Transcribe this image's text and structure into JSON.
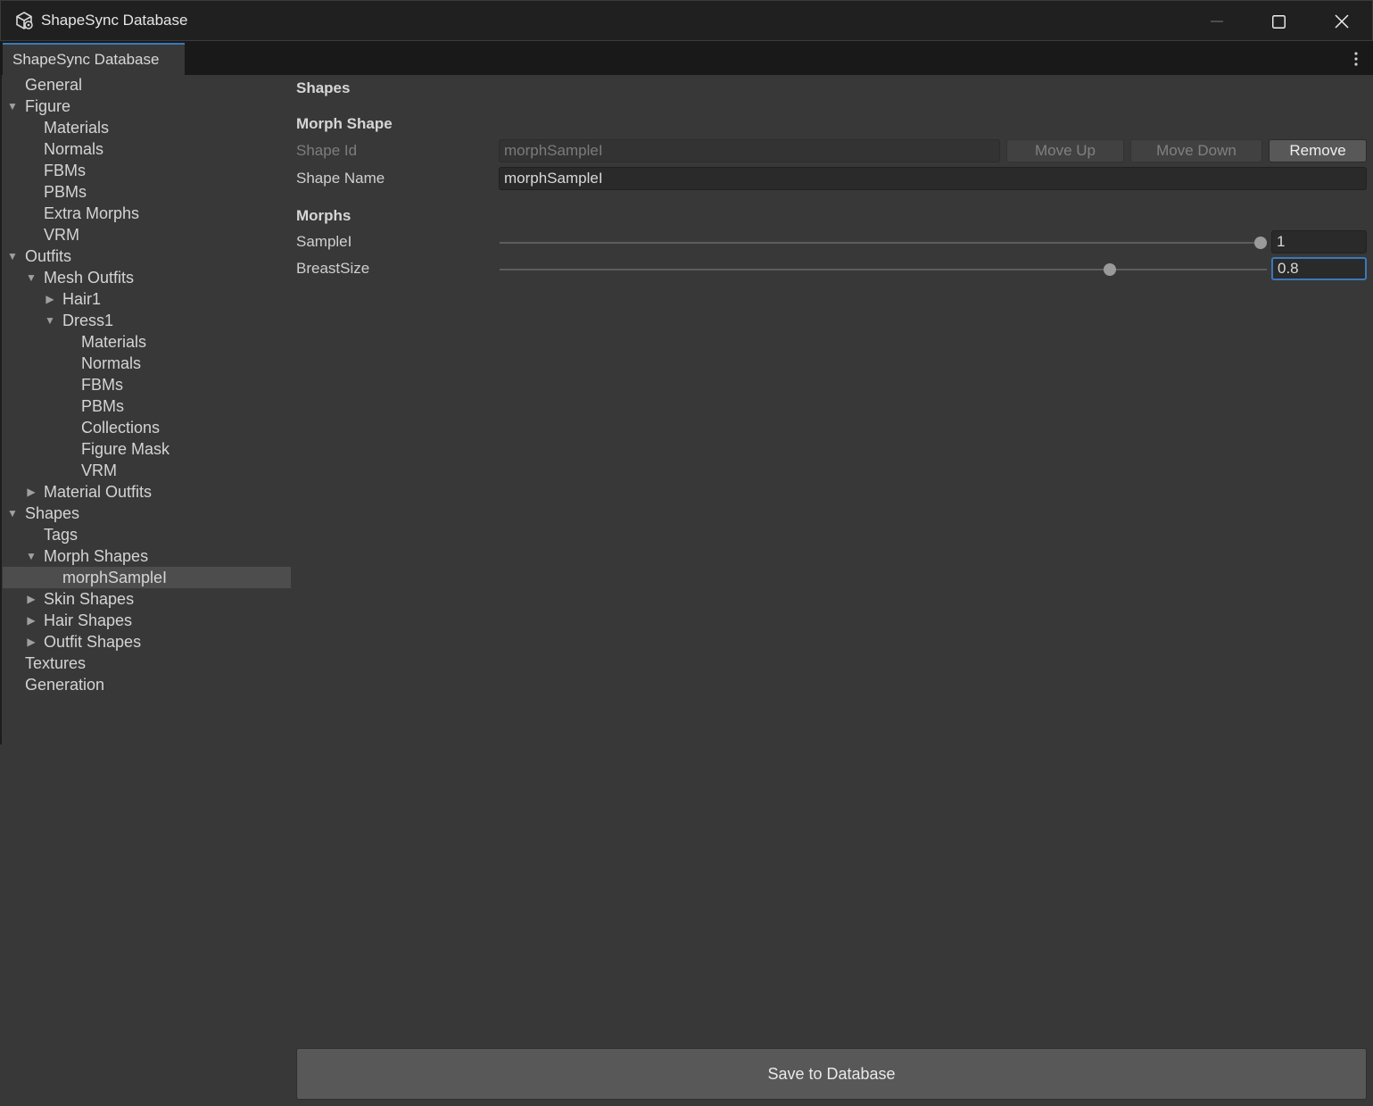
{
  "window": {
    "title": "ShapeSync Database",
    "icon": "unity-cube-icon",
    "controls": [
      "minimize-icon",
      "maximize-icon",
      "close-icon"
    ]
  },
  "tab": {
    "label": "ShapeSync Database",
    "menu_icon": "kebab-menu-icon"
  },
  "tree": [
    {
      "label": "General",
      "depth": 0,
      "expander": "none"
    },
    {
      "label": "Figure",
      "depth": 0,
      "expander": "expanded"
    },
    {
      "label": "Materials",
      "depth": 1,
      "expander": "none"
    },
    {
      "label": "Normals",
      "depth": 1,
      "expander": "none"
    },
    {
      "label": "FBMs",
      "depth": 1,
      "expander": "none"
    },
    {
      "label": "PBMs",
      "depth": 1,
      "expander": "none"
    },
    {
      "label": "Extra Morphs",
      "depth": 1,
      "expander": "none"
    },
    {
      "label": "VRM",
      "depth": 1,
      "expander": "none"
    },
    {
      "label": "Outfits",
      "depth": 0,
      "expander": "expanded"
    },
    {
      "label": "Mesh Outfits",
      "depth": 1,
      "expander": "expanded"
    },
    {
      "label": "Hair1",
      "depth": 2,
      "expander": "collapsed"
    },
    {
      "label": "Dress1",
      "depth": 2,
      "expander": "expanded"
    },
    {
      "label": "Materials",
      "depth": 3,
      "expander": "none"
    },
    {
      "label": "Normals",
      "depth": 3,
      "expander": "none"
    },
    {
      "label": "FBMs",
      "depth": 3,
      "expander": "none"
    },
    {
      "label": "PBMs",
      "depth": 3,
      "expander": "none"
    },
    {
      "label": "Collections",
      "depth": 3,
      "expander": "none"
    },
    {
      "label": "Figure Mask",
      "depth": 3,
      "expander": "none"
    },
    {
      "label": "VRM",
      "depth": 3,
      "expander": "none"
    },
    {
      "label": "Material Outfits",
      "depth": 1,
      "expander": "collapsed"
    },
    {
      "label": "Shapes",
      "depth": 0,
      "expander": "expanded"
    },
    {
      "label": "Tags",
      "depth": 1,
      "expander": "none"
    },
    {
      "label": "Morph Shapes",
      "depth": 1,
      "expander": "expanded"
    },
    {
      "label": "morphSampleI",
      "depth": 2,
      "expander": "none",
      "selected": true
    },
    {
      "label": "Skin Shapes",
      "depth": 1,
      "expander": "collapsed"
    },
    {
      "label": "Hair Shapes",
      "depth": 1,
      "expander": "collapsed"
    },
    {
      "label": "Outfit Shapes",
      "depth": 1,
      "expander": "collapsed"
    },
    {
      "label": "Textures",
      "depth": 0,
      "expander": "none"
    },
    {
      "label": "Generation",
      "depth": 0,
      "expander": "none"
    }
  ],
  "main": {
    "header": "Shapes",
    "morph_shape_header": "Morph Shape",
    "shape_id_label": "Shape Id",
    "shape_id_value": "morphSampleI",
    "shape_name_label": "Shape Name",
    "shape_name_value": "morphSampleI",
    "buttons": {
      "move_up": "Move Up",
      "move_down": "Move Down",
      "remove": "Remove"
    },
    "morphs_header": "Morphs",
    "morphs": [
      {
        "label": "SampleI",
        "value": "1",
        "fraction": 1.0,
        "focused": false
      },
      {
        "label": "BreastSize",
        "value": "0.8",
        "fraction": 0.8,
        "focused": true
      }
    ],
    "save_button": "Save to Database"
  },
  "colors": {
    "accent": "#3a79bb",
    "background": "#383838",
    "titlebar": "#202020"
  }
}
